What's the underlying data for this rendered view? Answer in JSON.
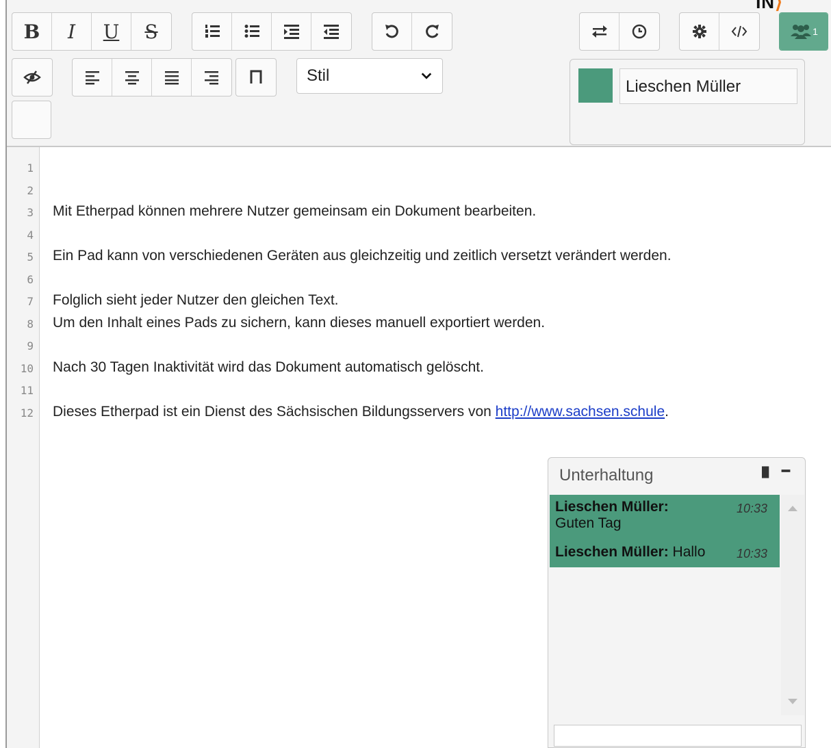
{
  "toolbar": {
    "bold": "B",
    "italic": "I",
    "underline": "U",
    "strike": "S",
    "user_count": "1",
    "style_select": "Stil"
  },
  "user_panel": {
    "name": "Lieschen Müller",
    "color": "#4b9a7c"
  },
  "editor": {
    "line_numbers": [
      "1",
      "2",
      "3",
      "4",
      "5",
      "6",
      "7",
      "8",
      "9",
      "10",
      "11",
      "12"
    ],
    "lines": [
      "",
      "",
      "Mit Etherpad können mehrere Nutzer gemeinsam ein Dokument bearbeiten.",
      "",
      "Ein Pad kann von verschiedenen Geräten aus gleichzeitig und zeitlich versetzt verändert werden.",
      "",
      "Folglich sieht jeder Nutzer den gleichen Text.",
      "Um den Inhalt eines Pads zu sichern, kann dieses manuell exportiert werden.",
      "",
      "Nach 30 Tagen Inaktivität wird das Dokument automatisch gelöscht.",
      "",
      "Dieses Etherpad ist ein Dienst des Sächsischen Bildungsservers von "
    ],
    "link_text": "http://www.sachsen.schule",
    "link_suffix": "."
  },
  "chat": {
    "title": "Unterhaltung",
    "messages": [
      {
        "author": "Lieschen Müller:",
        "text": "Guten Tag",
        "time": "10:33"
      },
      {
        "author": "Lieschen Müller:",
        "text": "Hallo",
        "time": "10:33"
      }
    ]
  },
  "colors": {
    "accent": "#4b9a7c",
    "users_button": "#62a98d",
    "logo_accent": "#f07a1a"
  },
  "logo_text": "IN"
}
